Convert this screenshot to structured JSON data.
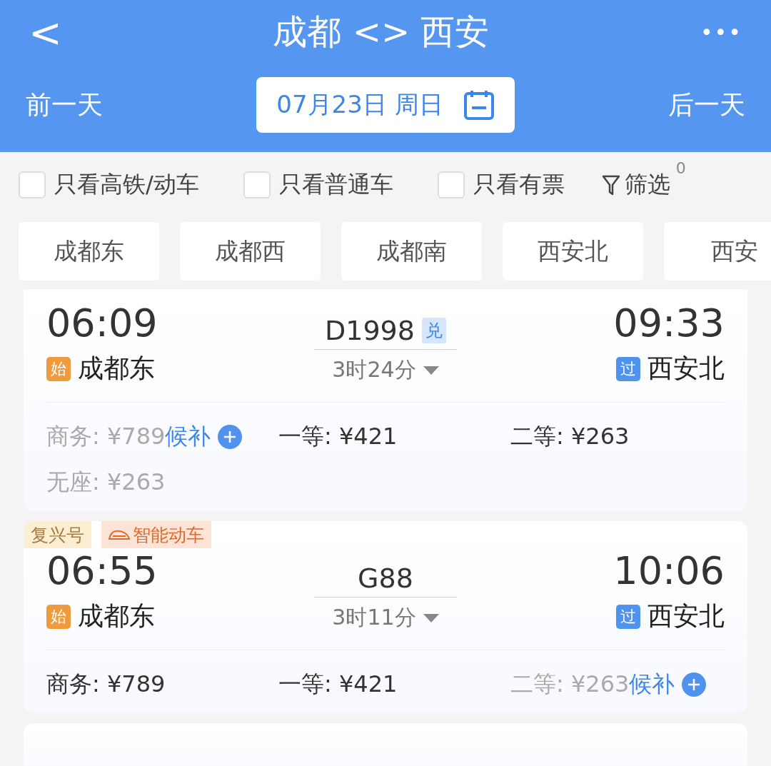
{
  "header": {
    "back": "<",
    "title": "成都 <> 西安",
    "more": "•••",
    "prev_day": "前一天",
    "date": "07月23日 周日",
    "next_day": "后一天"
  },
  "filters": [
    {
      "label": "只看高铁/动车",
      "checked": false
    },
    {
      "label": "只看普通车",
      "checked": false
    },
    {
      "label": "只看有票",
      "checked": false
    }
  ],
  "filter_button": {
    "label": "筛选",
    "count": "0"
  },
  "stations": [
    {
      "label": "成都东",
      "selected": false
    },
    {
      "label": "成都西",
      "selected": false
    },
    {
      "label": "成都南",
      "selected": false
    },
    {
      "label": "西安北",
      "selected": false
    },
    {
      "label": "西安",
      "selected": false
    }
  ],
  "trains": [
    {
      "depart_time": "06:09",
      "depart_station": "成都东",
      "depart_mark": {
        "text": "始",
        "kind": "origin"
      },
      "number": "D1998",
      "number_badge": "兑",
      "duration": "3时24分",
      "arrive_time": "09:33",
      "arrive_station": "西安北",
      "arrive_mark": {
        "text": "过",
        "kind": "passing"
      },
      "seats": [
        {
          "text": "商务: ¥789",
          "available": false,
          "waitlist": "候补"
        },
        {
          "text": "一等: ¥421",
          "available": true
        },
        {
          "text": "二等: ¥263",
          "available": true
        },
        {
          "text": "无座: ¥263",
          "available": false
        }
      ]
    },
    {
      "tags": [
        {
          "text": "复兴号",
          "kind": "plain"
        },
        {
          "text": "智能动车",
          "kind": "train"
        }
      ],
      "depart_time": "06:55",
      "depart_station": "成都东",
      "depart_mark": {
        "text": "始",
        "kind": "origin"
      },
      "number": "G88",
      "duration": "3时11分",
      "arrive_time": "10:06",
      "arrive_station": "西安北",
      "arrive_mark": {
        "text": "过",
        "kind": "passing"
      },
      "seats": [
        {
          "text": "商务: ¥789",
          "available": true
        },
        {
          "text": "一等: ¥421",
          "available": true
        },
        {
          "text": "二等: ¥263",
          "available": false,
          "waitlist": "候补"
        }
      ]
    }
  ]
}
